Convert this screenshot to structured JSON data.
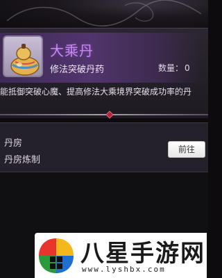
{
  "item": {
    "name": "大乘丹",
    "subtitle": "修法突破丹药",
    "quantity_label": "数量：",
    "quantity_value": "0",
    "description": "能抵御突破心魔、提高修法大乘境界突破成功率的丹",
    "icon": "gourd-pill-icon",
    "name_color": "#c88af0"
  },
  "workshop": {
    "title": "丹房",
    "desc": "丹房炼制",
    "goto_label": "前往"
  },
  "watermark": {
    "text": "八星手游网",
    "url": "www.lyshbx.com"
  }
}
